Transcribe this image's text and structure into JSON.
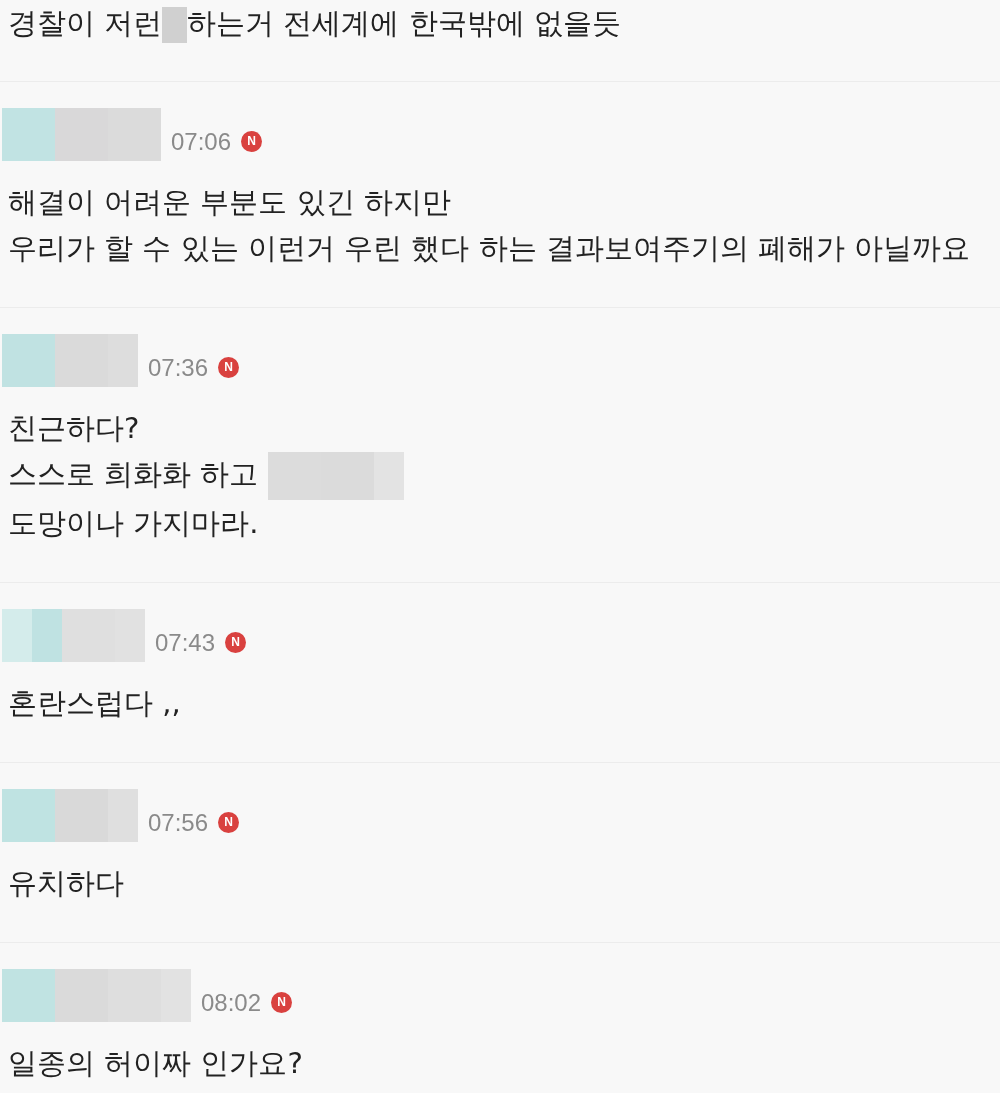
{
  "comments": [
    {
      "body": [
        [
          {
            "kind": "text",
            "text": "경찰이 저런"
          },
          {
            "kind": "mosaic",
            "tiles": [
              {
                "kind": "slim",
                "color": "#d0d0d0"
              }
            ]
          },
          {
            "kind": "text",
            "text": "하는거 전세계에 한국밖에 없을듯"
          }
        ]
      ]
    },
    {
      "author": {
        "tiles": [
          {
            "kind": "wide",
            "color": "#c1e3e3"
          },
          {
            "kind": "wide",
            "color": "#d9d8d9"
          },
          {
            "kind": "wide",
            "color": "#dbdbdb"
          }
        ]
      },
      "time": "07:06",
      "badge": "N",
      "body": [
        [
          {
            "kind": "text",
            "text": "해결이 어려운 부분도 있긴 하지만"
          }
        ],
        [
          {
            "kind": "text",
            "text": "우리가 할 수 있는 이런거 우린 했다 하는 결과보여주기의 폐해가 아닐까요"
          }
        ]
      ]
    },
    {
      "author": {
        "tiles": [
          {
            "kind": "wide",
            "color": "#c0e2e2"
          },
          {
            "kind": "wide",
            "color": "#dadada"
          },
          {
            "kind": "narrow",
            "color": "#dddddd"
          }
        ]
      },
      "time": "07:36",
      "badge": "N",
      "body": [
        [
          {
            "kind": "text",
            "text": "친근하다?"
          }
        ],
        [
          {
            "kind": "text",
            "text": "스스로 희화화 하고 "
          },
          {
            "kind": "mosaic",
            "tiles": [
              {
                "kind": "wide",
                "color": "#dcdcdc"
              },
              {
                "kind": "wide",
                "color": "#dbdbdb"
              },
              {
                "kind": "narrow",
                "color": "#e3e3e3"
              }
            ]
          }
        ],
        [
          {
            "kind": "text",
            "text": "도망이나 가지마라."
          }
        ]
      ]
    },
    {
      "author": {
        "tiles": [
          {
            "kind": "narrow",
            "color": "#d4eceb"
          },
          {
            "kind": "narrow",
            "color": "#bfe2e2"
          },
          {
            "kind": "wide",
            "color": "#dfdfdf"
          },
          {
            "kind": "narrow",
            "color": "#e1e1e1"
          }
        ]
      },
      "time": "07:43",
      "badge": "N",
      "body": [
        [
          {
            "kind": "text",
            "text": "혼란스럽다 ,,"
          }
        ]
      ]
    },
    {
      "author": {
        "tiles": [
          {
            "kind": "wide",
            "color": "#bfe3e2"
          },
          {
            "kind": "wide",
            "color": "#d9d9d9"
          },
          {
            "kind": "narrow",
            "color": "#dfdfdf"
          }
        ]
      },
      "time": "07:56",
      "badge": "N",
      "body": [
        [
          {
            "kind": "text",
            "text": "유치하다"
          }
        ]
      ]
    },
    {
      "author": {
        "tiles": [
          {
            "kind": "wide",
            "color": "#c0e3e2"
          },
          {
            "kind": "wide",
            "color": "#dadada"
          },
          {
            "kind": "wide",
            "color": "#dedede"
          },
          {
            "kind": "narrow",
            "color": "#e2e2e2"
          }
        ]
      },
      "time": "08:02",
      "badge": "N",
      "body": [
        [
          {
            "kind": "text",
            "text": "일종의 허이짜 인가요?"
          }
        ]
      ]
    }
  ]
}
